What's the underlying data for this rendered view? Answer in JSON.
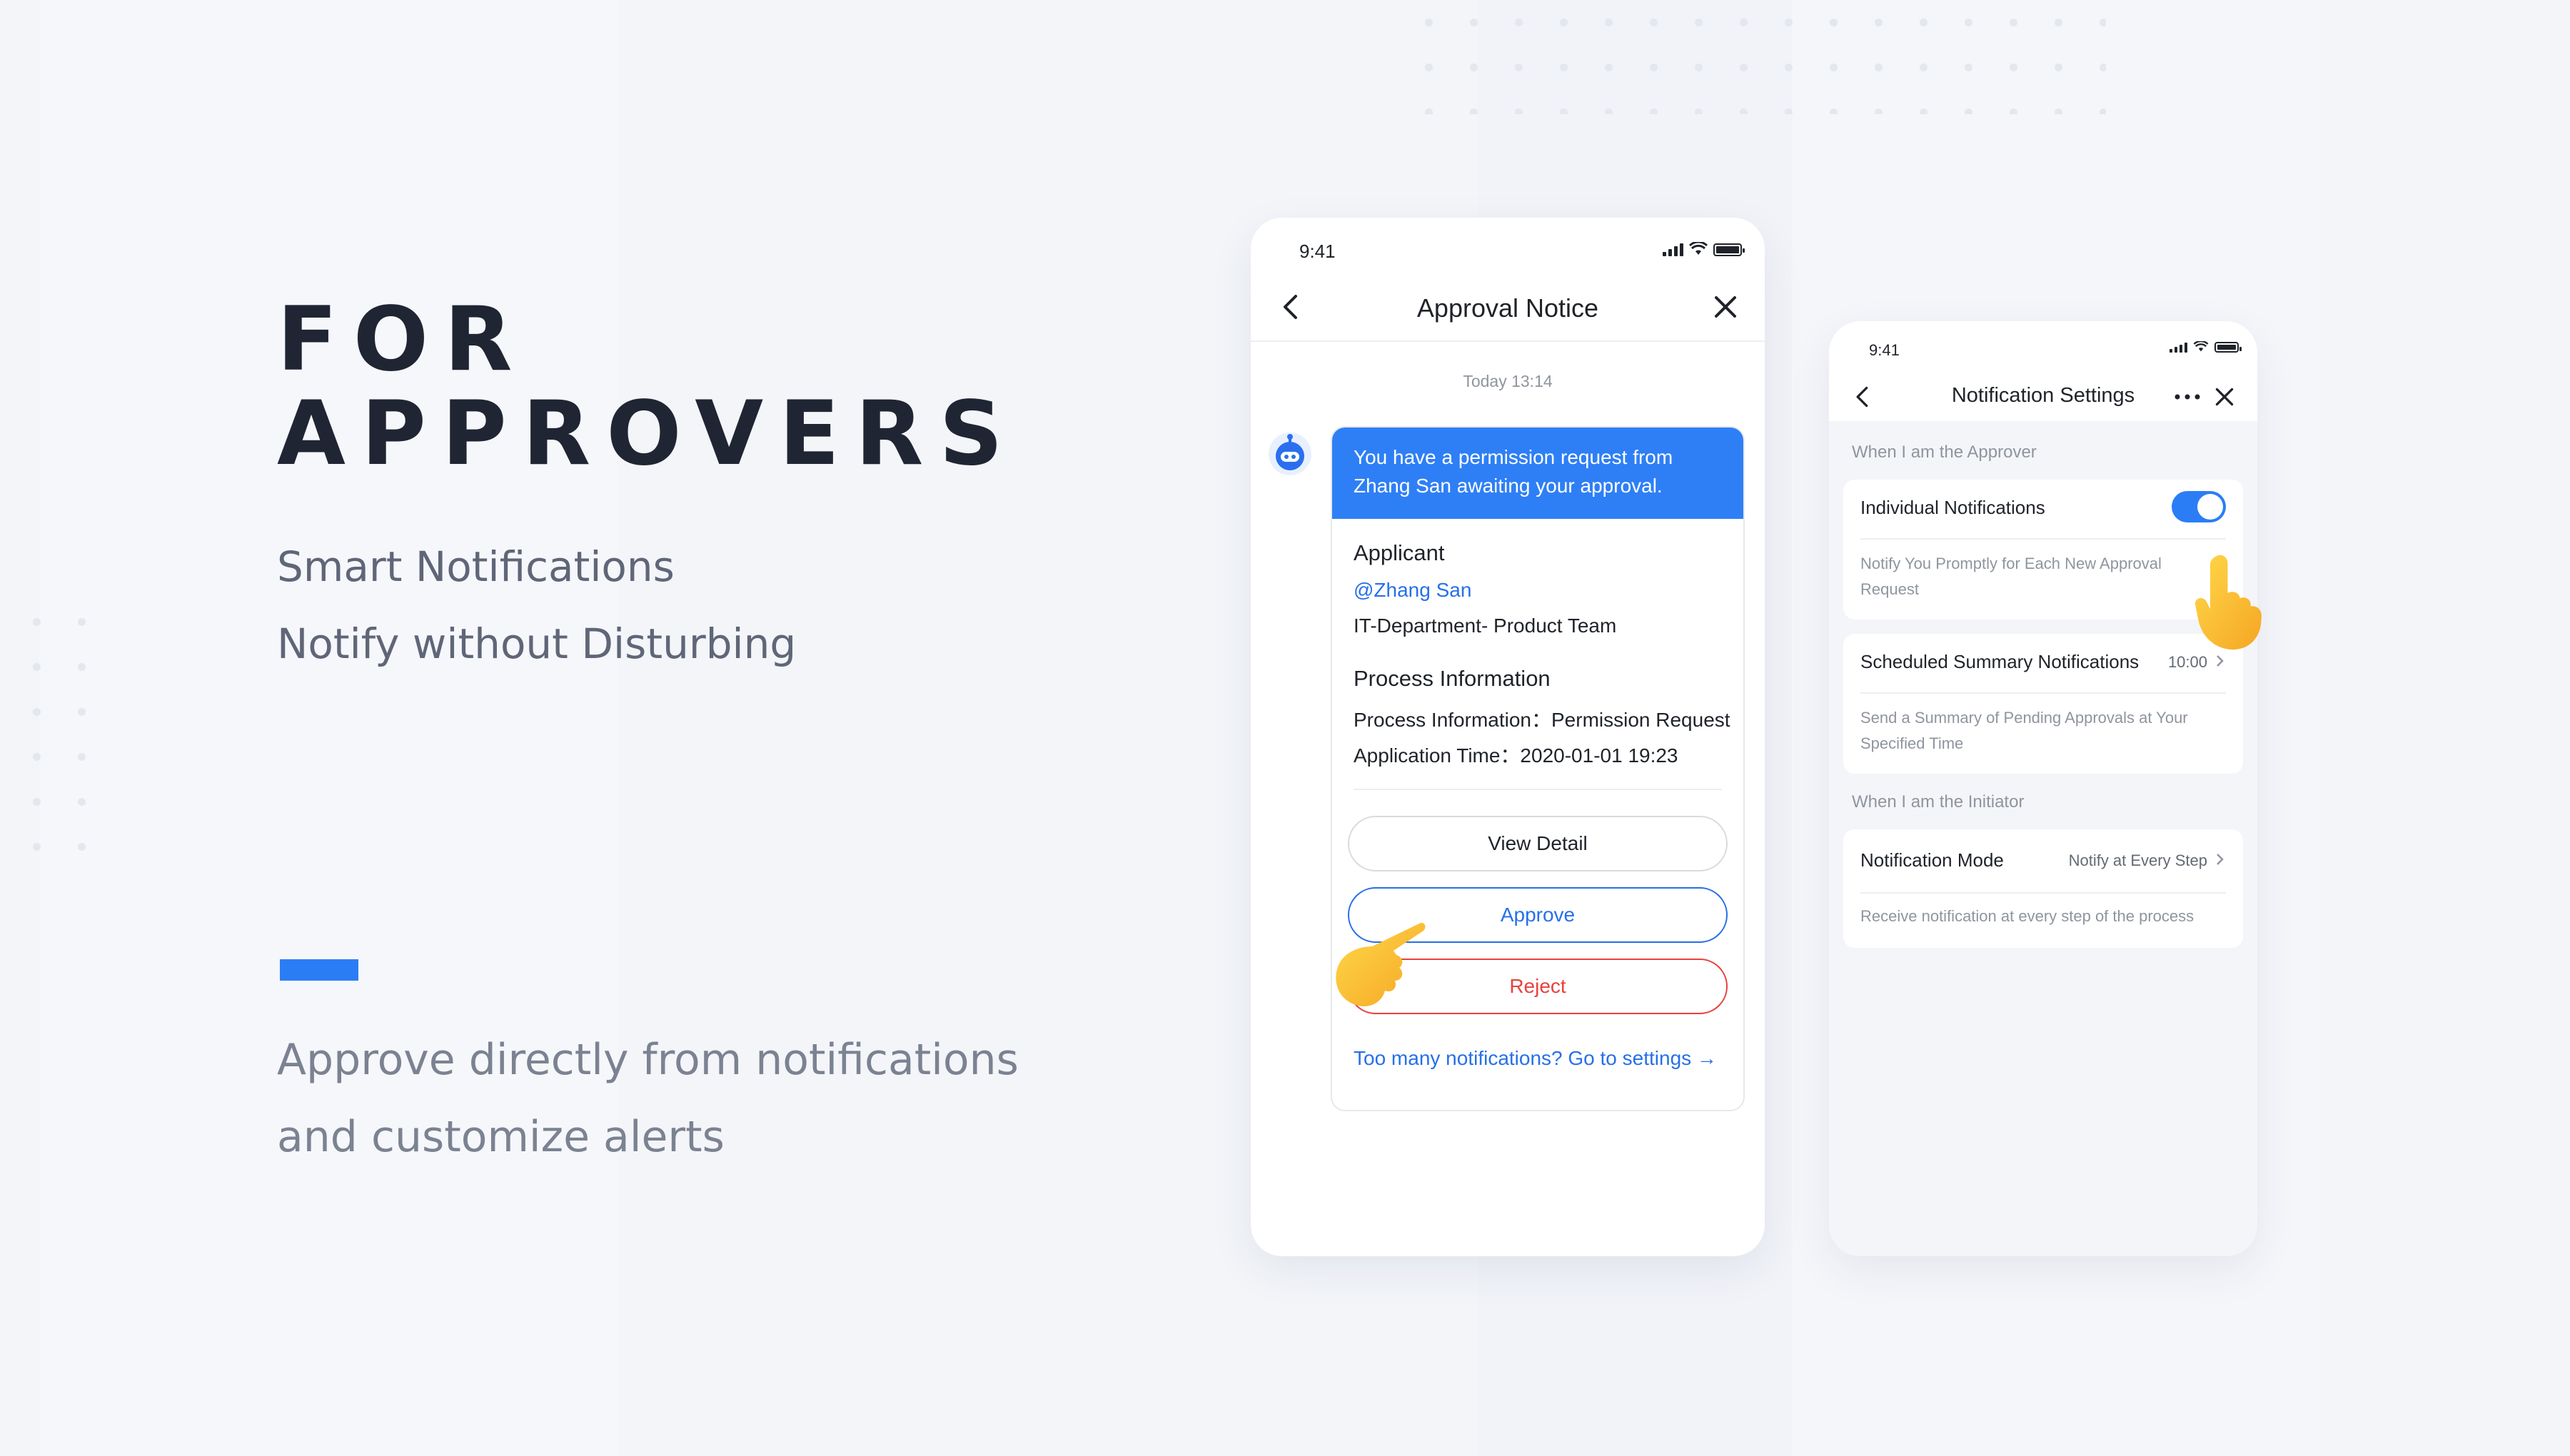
{
  "hero": {
    "title": "FOR\nAPPROVERS",
    "subtitle_1": "Smart Notifications",
    "subtitle_2": "Notify without Disturbing",
    "desc_1": "Approve directly from notifications",
    "desc_2": "and customize alerts"
  },
  "colors": {
    "accent": "#2b7df6",
    "reject": "#e8413d",
    "link": "#2670e8"
  },
  "approval_phone": {
    "status_time": "9:41",
    "nav_title": "Approval Notice",
    "back_icon": "chevron-left-icon",
    "close_icon": "close-icon",
    "timestamp": "Today 13:14",
    "message": "You have a permission request from Zhang San awaiting your approval.",
    "applicant_title": "Applicant",
    "applicant_mention": "@Zhang San",
    "applicant_dept": "IT-Department- Product Team",
    "process_title": "Process Information",
    "process_line": "Process Information：Permission Request",
    "time_line": "Application Time：2020-01-01 19:23",
    "view_detail": "View Detail",
    "approve": "Approve",
    "reject": "Reject",
    "settings_link": "Too many notifications? Go to settings →"
  },
  "settings_phone": {
    "status_time": "9:41",
    "nav_title": "Notification Settings",
    "more_icon": "more-icon",
    "section_approver": "When I am the Approver",
    "individual_title": "Individual Notifications",
    "individual_enabled": true,
    "individual_desc": "Notify You Promptly for Each New Approval Request",
    "summary_title": "Scheduled Summary Notifications",
    "summary_value": "10:00",
    "summary_desc": "Send a Summary of Pending Approvals at Your Specified Time",
    "section_initiator": "When I am the Initiator",
    "mode_title": "Notification Mode",
    "mode_value": "Notify at Every Step",
    "mode_desc": "Receive notification at every step of the process"
  }
}
